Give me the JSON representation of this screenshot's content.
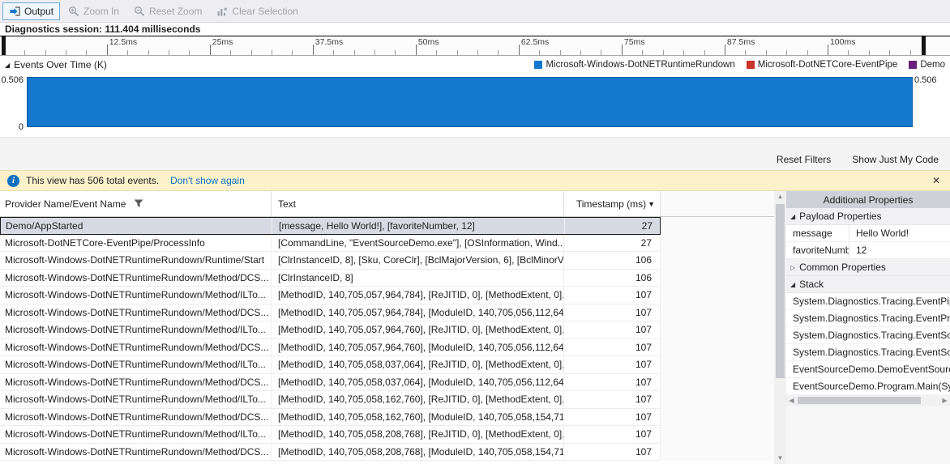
{
  "toolbar": {
    "output_label": "Output",
    "zoom_in_label": "Zoom In",
    "reset_zoom_label": "Reset Zoom",
    "clear_selection_label": "Clear Selection"
  },
  "session": {
    "label": "Diagnostics session: 111.404 milliseconds",
    "length_ms": 111.404
  },
  "ruler": {
    "ticks": [
      {
        "value": 12.5,
        "label": "12.5ms"
      },
      {
        "value": 25,
        "label": "25ms"
      },
      {
        "value": 37.5,
        "label": "37.5ms"
      },
      {
        "value": 50,
        "label": "50ms"
      },
      {
        "value": 62.5,
        "label": "62.5ms"
      },
      {
        "value": 75,
        "label": "75ms"
      },
      {
        "value": 87.5,
        "label": "87.5ms"
      },
      {
        "value": 100,
        "label": "100ms"
      }
    ]
  },
  "events_chart": {
    "title": "Events Over Time (K)",
    "y_max_label": "0.506",
    "y_min_label": "0",
    "legend": [
      {
        "label": "Microsoft-Windows-DotNETRuntimeRundown",
        "color": "#1378ce"
      },
      {
        "label": "Microsoft-DotNETCore-EventPipe",
        "color": "#c8332a"
      },
      {
        "label": "Demo",
        "color": "#68217a"
      }
    ]
  },
  "chart_data": {
    "type": "area",
    "title": "Events Over Time (K)",
    "x_unit": "ms",
    "x_range": [
      0,
      111.404
    ],
    "ylim": [
      0,
      0.506
    ],
    "y_tick_labels": [
      "0",
      "0.506"
    ],
    "legend_position": "top-right",
    "total_events": 506,
    "series": [
      {
        "name": "Microsoft-Windows-DotNETRuntimeRundown",
        "color": "#1378ce",
        "x": [
          0,
          111.404
        ],
        "values": [
          0.506,
          0.506
        ]
      },
      {
        "name": "Microsoft-DotNETCore-EventPipe",
        "color": "#c8332a",
        "x": [
          0,
          111.404
        ],
        "values": [
          0,
          0
        ]
      },
      {
        "name": "Demo",
        "color": "#68217a",
        "x": [
          0,
          111.404
        ],
        "values": [
          0,
          0
        ]
      }
    ]
  },
  "filter_links": {
    "reset_filters": "Reset Filters",
    "show_just_my_code": "Show Just My Code"
  },
  "info_bar": {
    "message": "This view has 506 total events.",
    "dismiss_link": "Don't show again",
    "close_glyph": "✕"
  },
  "table": {
    "columns": [
      "Provider Name/Event Name",
      "Text",
      "Timestamp (ms)"
    ],
    "rows": [
      {
        "provider": "Demo/AppStarted",
        "text": "[message, Hello World!], [favoriteNumber, 12]",
        "timestamp": "27",
        "selected": true
      },
      {
        "provider": "Microsoft-DotNETCore-EventPipe/ProcessInfo",
        "text": "[CommandLine, \"EventSourceDemo.exe\"], [OSInformation, Wind...",
        "timestamp": "27"
      },
      {
        "provider": "Microsoft-Windows-DotNETRuntimeRundown/Runtime/Start",
        "text": "[ClrInstanceID, 8], [Sku, CoreClr], [BclMajorVersion, 6], [BclMinorV...",
        "timestamp": "106"
      },
      {
        "provider": "Microsoft-Windows-DotNETRuntimeRundown/Method/DCS...",
        "text": "[ClrInstanceID, 8]",
        "timestamp": "106"
      },
      {
        "provider": "Microsoft-Windows-DotNETRuntimeRundown/Method/ILTo...",
        "text": "[MethodID, 140,705,057,964,784], [ReJITID, 0], [MethodExtent, 0],...",
        "timestamp": "107"
      },
      {
        "provider": "Microsoft-Windows-DotNETRuntimeRundown/Method/DCS...",
        "text": "[MethodID, 140,705,057,964,784], [ModuleID, 140,705,056,112,64...",
        "timestamp": "107"
      },
      {
        "provider": "Microsoft-Windows-DotNETRuntimeRundown/Method/ILTo...",
        "text": "[MethodID, 140,705,057,964,760], [ReJITID, 0], [MethodExtent, 0],...",
        "timestamp": "107"
      },
      {
        "provider": "Microsoft-Windows-DotNETRuntimeRundown/Method/DCS...",
        "text": "[MethodID, 140,705,057,964,760], [ModuleID, 140,705,056,112,64...",
        "timestamp": "107"
      },
      {
        "provider": "Microsoft-Windows-DotNETRuntimeRundown/Method/ILTo...",
        "text": "[MethodID, 140,705,058,037,064], [ReJITID, 0], [MethodExtent, 0],...",
        "timestamp": "107"
      },
      {
        "provider": "Microsoft-Windows-DotNETRuntimeRundown/Method/DCS...",
        "text": "[MethodID, 140,705,058,037,064], [ModuleID, 140,705,056,112,64...",
        "timestamp": "107"
      },
      {
        "provider": "Microsoft-Windows-DotNETRuntimeRundown/Method/ILTo...",
        "text": "[MethodID, 140,705,058,162,760], [ReJITID, 0], [MethodExtent, 0],...",
        "timestamp": "107"
      },
      {
        "provider": "Microsoft-Windows-DotNETRuntimeRundown/Method/DCS...",
        "text": "[MethodID, 140,705,058,162,760], [ModuleID, 140,705,058,154,71...",
        "timestamp": "107"
      },
      {
        "provider": "Microsoft-Windows-DotNETRuntimeRundown/Method/ILTo...",
        "text": "[MethodID, 140,705,058,208,768], [ReJITID, 0], [MethodExtent, 0],...",
        "timestamp": "107"
      },
      {
        "provider": "Microsoft-Windows-DotNETRuntimeRundown/Method/DCS...",
        "text": "[MethodID, 140,705,058,208,768], [ModuleID, 140,705,058,154,71...",
        "timestamp": "107"
      }
    ]
  },
  "panel": {
    "title": "Additional Properties",
    "payload_group": "Payload Properties",
    "common_group": "Common Properties",
    "stack_group": "Stack",
    "properties": [
      {
        "name": "message",
        "value": "Hello World!"
      },
      {
        "name": "favoriteNumber",
        "value": "12"
      }
    ],
    "stack_frames": [
      "System.Diagnostics.Tracing.EventPip",
      "System.Diagnostics.Tracing.EventPro",
      "System.Diagnostics.Tracing.EventSou",
      "System.Diagnostics.Tracing.EventSou",
      "EventSourceDemo.DemoEventSourc",
      "EventSourceDemo.Program.Main(Sy"
    ]
  }
}
